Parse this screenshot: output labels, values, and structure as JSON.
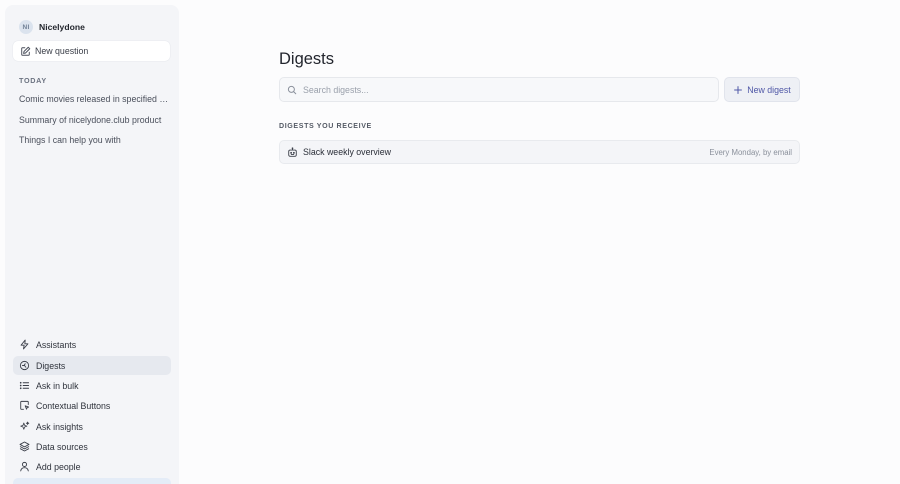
{
  "workspace": {
    "initials": "NI",
    "name": "Nicelydone"
  },
  "sidebar": {
    "new_question": "New question",
    "section_label": "TODAY",
    "history": [
      "Comic movies released in specified d...",
      "Summary of nicelydone.club product",
      "Things I can help you with"
    ],
    "nav": [
      {
        "label": "Assistants",
        "icon": "lightning-icon"
      },
      {
        "label": "Digests",
        "icon": "digest-icon",
        "active": true
      },
      {
        "label": "Ask in bulk",
        "icon": "list-icon"
      },
      {
        "label": "Contextual Buttons",
        "icon": "cursor-box-icon"
      },
      {
        "label": "Ask insights",
        "icon": "sparkles-icon"
      },
      {
        "label": "Data sources",
        "icon": "layers-icon"
      },
      {
        "label": "Add people",
        "icon": "person-icon"
      }
    ]
  },
  "main": {
    "title": "Digests",
    "search_placeholder": "Search digests...",
    "new_digest": "New digest",
    "section_label": "DIGESTS YOU RECEIVE",
    "digests": [
      {
        "name": "Slack weekly overview",
        "schedule": "Every Monday, by email",
        "icon": "robot-icon"
      }
    ]
  },
  "colors": {
    "accent": "#4f57a6",
    "sidebar_bg": "#f4f5f8",
    "active_bg": "#e6e9ef"
  }
}
